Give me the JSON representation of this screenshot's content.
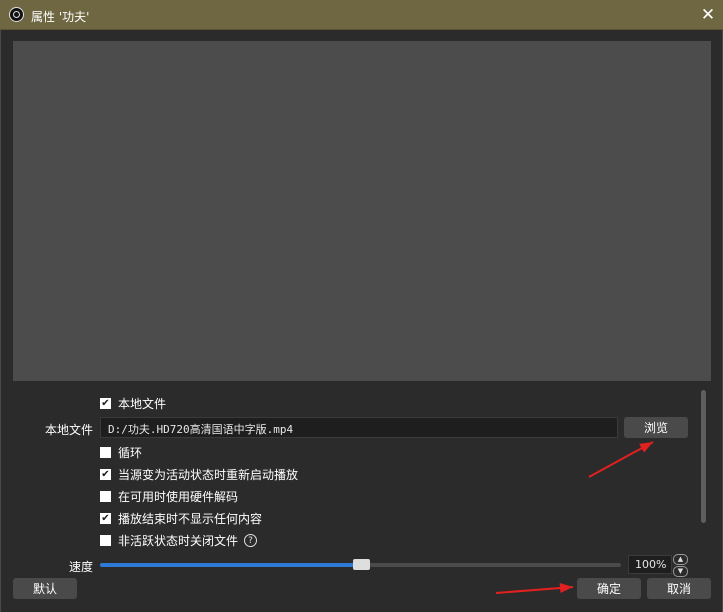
{
  "window": {
    "title": "属性 '功夫'"
  },
  "checkboxes": [
    {
      "label": "本地文件",
      "checked": true
    },
    {
      "label": "循环",
      "checked": false
    },
    {
      "label": "当源变为活动状态时重新启动播放",
      "checked": true
    },
    {
      "label": "在可用时使用硬件解码",
      "checked": false
    },
    {
      "label": "播放结束时不显示任何内容",
      "checked": true
    },
    {
      "label": "非活跃状态时关闭文件",
      "checked": false
    }
  ],
  "local_file": {
    "label": "本地文件",
    "path": "D:/功夫.HD720高清国语中字版.mp4",
    "browse_label": "浏览"
  },
  "speed": {
    "label": "速度",
    "value": "100%",
    "slider_fraction": 0.5
  },
  "footer": {
    "defaults_label": "默认",
    "ok_label": "确定",
    "cancel_label": "取消"
  },
  "colors": {
    "titlebar": "#6e6742",
    "slider_fill": "#2d7bd6",
    "annotation_arrow": "#e32020"
  },
  "icons": {
    "check": "✔",
    "close": "✕",
    "help": "?",
    "up": "▲",
    "down": "▼"
  }
}
